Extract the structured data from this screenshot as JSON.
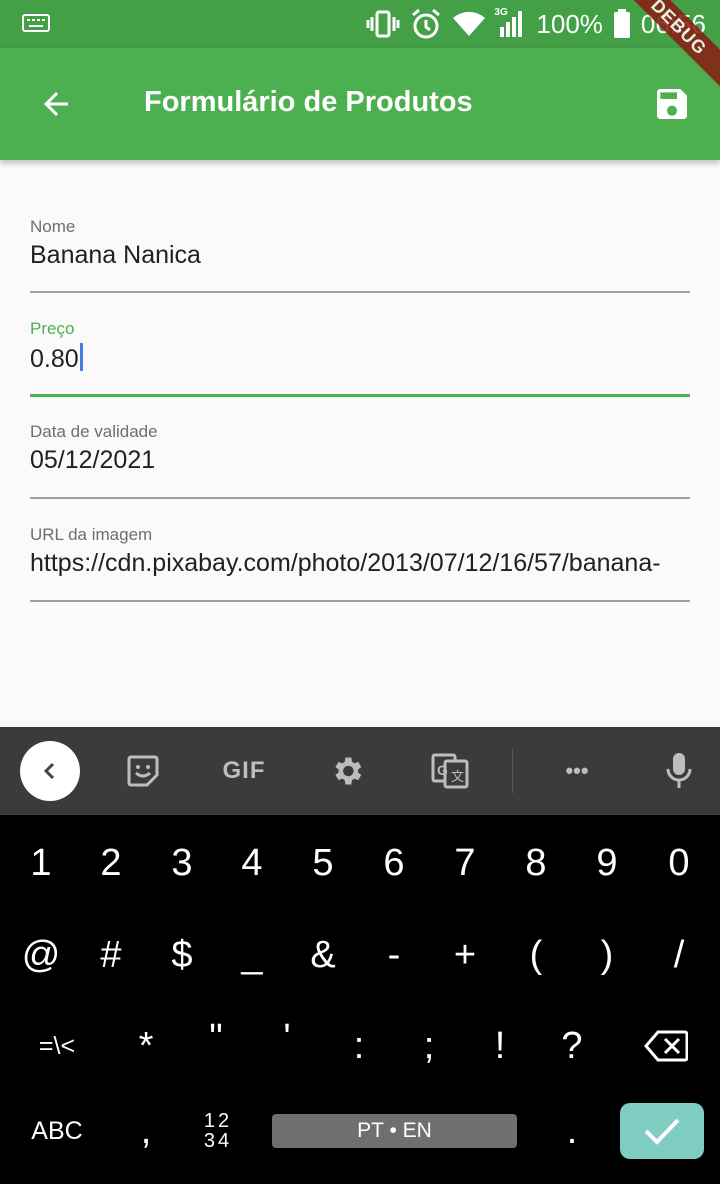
{
  "status_bar": {
    "battery": "100%",
    "time": "06:56",
    "network": "3G"
  },
  "app_bar": {
    "title": "Formulário de Produtos",
    "debug_banner": "DEBUG"
  },
  "form": {
    "fields": [
      {
        "label": "Nome",
        "value": "Banana Nanica"
      },
      {
        "label": "Preço",
        "value": "0.80"
      },
      {
        "label": "Data de validade",
        "value": "05/12/2021"
      },
      {
        "label": "URL da imagem",
        "value": "https://cdn.pixabay.com/photo/2013/07/12/16/57/banana-"
      }
    ]
  },
  "keyboard": {
    "toolbar": {
      "gif_label": "GIF",
      "more": "•••"
    },
    "row1": [
      "1",
      "2",
      "3",
      "4",
      "5",
      "6",
      "7",
      "8",
      "9",
      "0"
    ],
    "row2": [
      "@",
      "#",
      "$",
      "_",
      "&",
      "-",
      "+",
      "(",
      ")",
      "/"
    ],
    "row3": [
      "=\\<",
      "*",
      "\"",
      "'",
      ":",
      ";",
      "!",
      "?"
    ],
    "bottom": {
      "abc": "ABC",
      "comma": ",",
      "num_top": "12",
      "num_bottom": "34",
      "space": "PT • EN",
      "period": "."
    }
  },
  "colors": {
    "primary": "#4caf50",
    "status_bar": "#43a047",
    "accent_cursor": "#4a7dde",
    "enter_key": "#7fccc3"
  }
}
